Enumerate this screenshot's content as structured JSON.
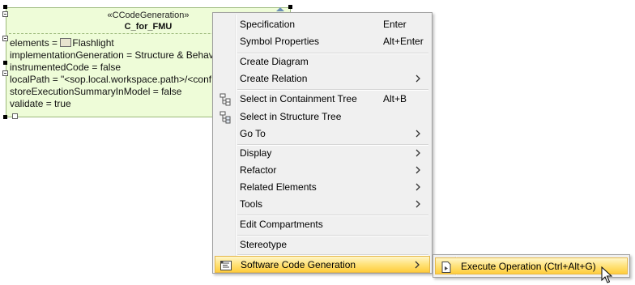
{
  "diagram_shape": {
    "stereotype": "«CCodeGeneration»",
    "name": "C_for_FMU",
    "fill_color": "#eefcd8",
    "properties": [
      {
        "text": "elements = ",
        "element_icon": "element-icon",
        "element_name": "Flashlight"
      },
      {
        "text": "implementationGeneration = Structure & Behav"
      },
      {
        "text": "instrumentedCode = false"
      },
      {
        "text": "localPath = \"<sop.local.workspace.path>/<conf"
      },
      {
        "text": "storeExecutionSummaryInModel = false"
      },
      {
        "text": "validate = true"
      }
    ]
  },
  "context_menu": {
    "items": [
      {
        "label": "Specification",
        "shortcut": "Enter"
      },
      {
        "label": "Symbol Properties",
        "shortcut": "Alt+Enter"
      },
      {
        "label": "Create Diagram"
      },
      {
        "label": "Create Relation",
        "submenu": true
      },
      {
        "label": "Select in Containment Tree",
        "shortcut": "Alt+B",
        "icon": "containment-tree-icon"
      },
      {
        "label": "Select in Structure Tree",
        "icon": "structure-tree-icon"
      },
      {
        "label": "Go To",
        "submenu": true
      },
      {
        "label": "Display",
        "submenu": true
      },
      {
        "label": "Refactor",
        "submenu": true
      },
      {
        "label": "Related Elements",
        "submenu": true
      },
      {
        "label": "Tools",
        "submenu": true
      },
      {
        "label": "Edit Compartments"
      },
      {
        "label": "Stereotype"
      },
      {
        "label": "Software Code Generation",
        "submenu": true,
        "highlighted": true,
        "icon": "code-generation-icon"
      }
    ]
  },
  "submenu": {
    "items": [
      {
        "label": "Execute Operation (Ctrl+Alt+G)",
        "highlighted": true,
        "icon": "execute-operation-icon"
      }
    ]
  },
  "colors": {
    "highlight_top": "#fff6c9",
    "highlight_bottom": "#ffcd3c",
    "menu_background": "#f0f0f0"
  }
}
